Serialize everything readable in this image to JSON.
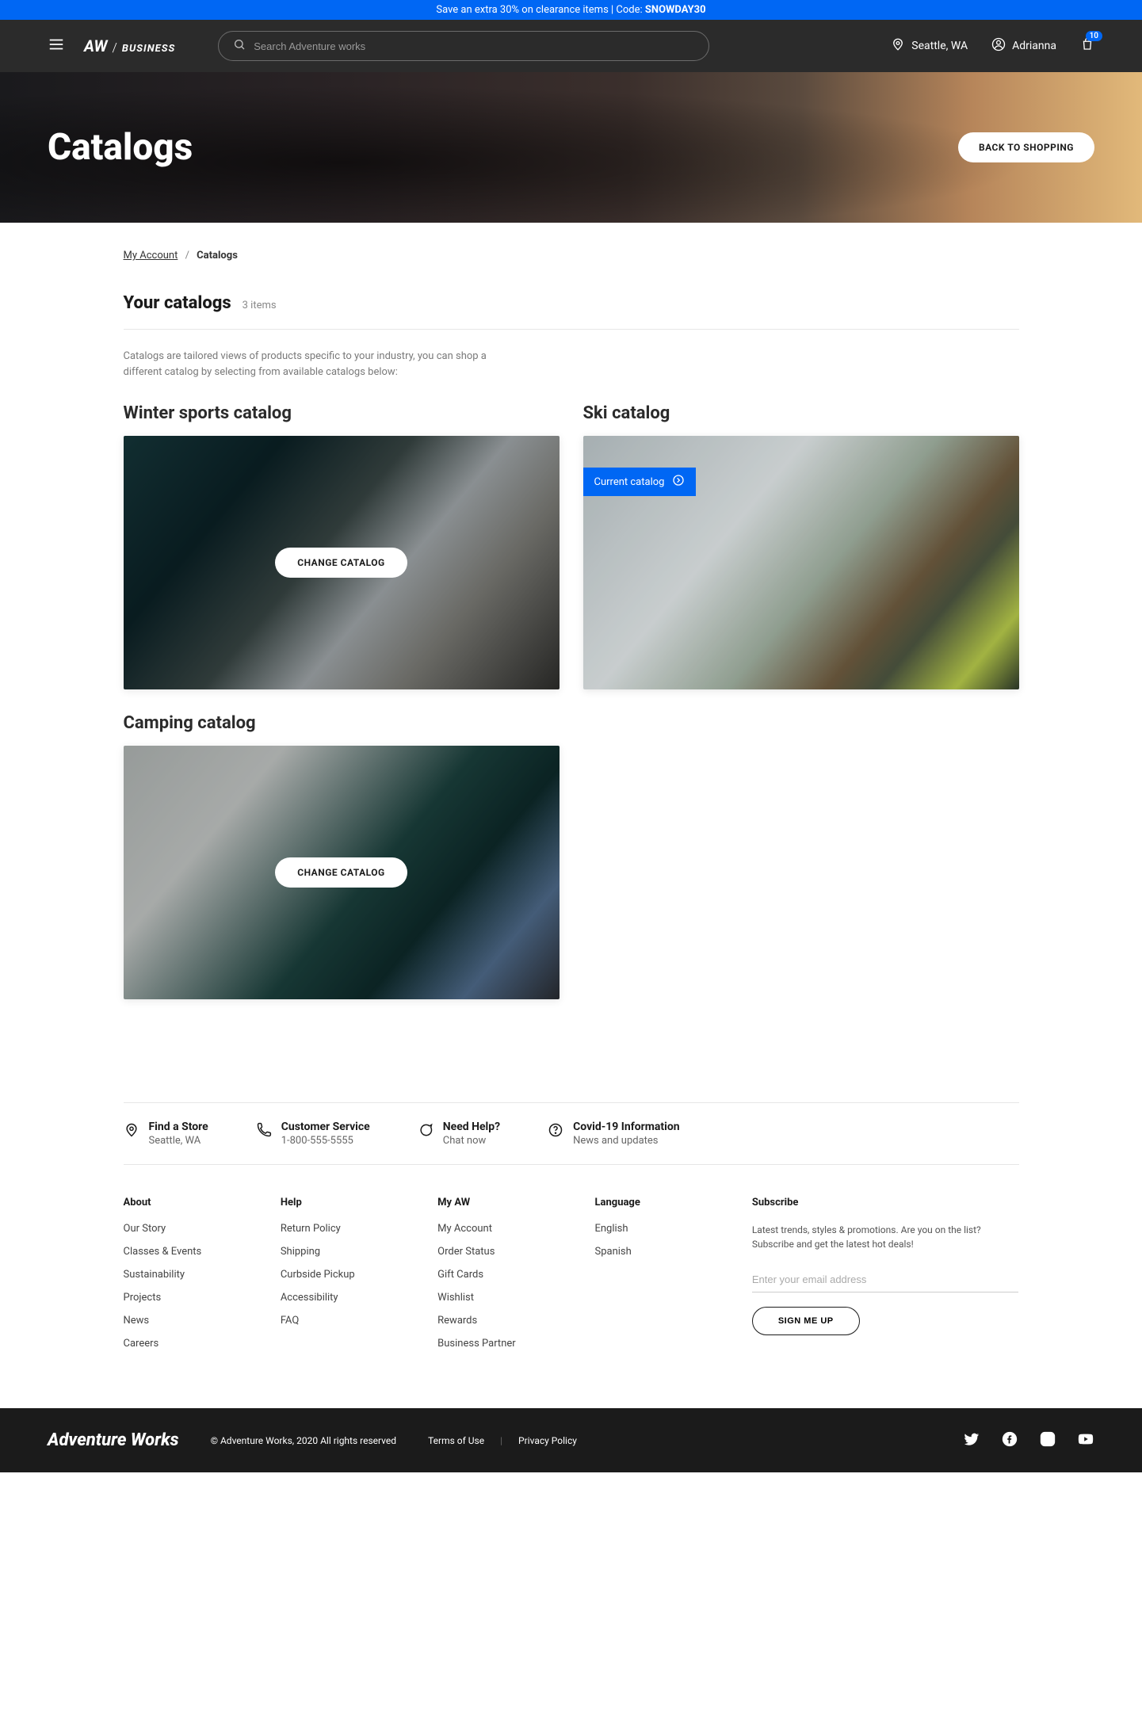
{
  "promo": {
    "text": "Save an extra 30% on clearance items | Code: ",
    "code": "SNOWDAY30"
  },
  "header": {
    "logo_aw": "AW",
    "logo_biz": "BUSINESS",
    "search_placeholder": "Search Adventure works",
    "location": "Seattle, WA",
    "user": "Adrianna",
    "cart_count": "10"
  },
  "hero": {
    "title": "Catalogs",
    "cta": "BACK TO SHOPPING"
  },
  "breadcrumb": {
    "root": "My Account",
    "current": "Catalogs"
  },
  "page": {
    "title": "Your catalogs",
    "count": "3 items",
    "intro": "Catalogs are tailored views of products specific to your industry, you can shop a different catalog by selecting from available catalogs below:"
  },
  "catalogs": [
    {
      "title": "Winter sports catalog",
      "cta": "CHANGE CATALOG",
      "current": false,
      "klass": "winter"
    },
    {
      "title": "Ski catalog",
      "chip": "Current catalog",
      "current": true,
      "klass": "ski"
    },
    {
      "title": "Camping catalog",
      "cta": "CHANGE CATALOG",
      "current": false,
      "klass": "camping"
    }
  ],
  "support": [
    {
      "title": "Find a Store",
      "sub": "Seattle, WA"
    },
    {
      "title": "Customer Service",
      "sub": "1-800-555-5555"
    },
    {
      "title": "Need Help?",
      "sub": "Chat now"
    },
    {
      "title": "Covid-19 Information",
      "sub": "News and updates"
    }
  ],
  "footer": {
    "about": {
      "h": "About",
      "items": [
        "Our Story",
        "Classes & Events",
        "Sustainability",
        "Projects",
        "News",
        "Careers"
      ]
    },
    "help": {
      "h": "Help",
      "items": [
        "Return Policy",
        "Shipping",
        "Curbside Pickup",
        "Accessibility",
        "FAQ"
      ]
    },
    "myaw": {
      "h": "My AW",
      "items": [
        "My Account",
        "Order Status",
        "Gift Cards",
        "Wishlist",
        "Rewards",
        "Business Partner"
      ]
    },
    "lang": {
      "h": "Language",
      "items": [
        "English",
        "Spanish"
      ]
    },
    "subscribe": {
      "h": "Subscribe",
      "desc": "Latest trends, styles & promotions. Are you on the list? Subscribe and get the latest hot deals!",
      "placeholder": "Enter your email address",
      "cta": "SIGN ME UP"
    }
  },
  "footerbar": {
    "logo": "Adventure Works",
    "copyright": "© Adventure Works, 2020 All rights reserved",
    "terms": "Terms of Use",
    "privacy": "Privacy Policy"
  }
}
